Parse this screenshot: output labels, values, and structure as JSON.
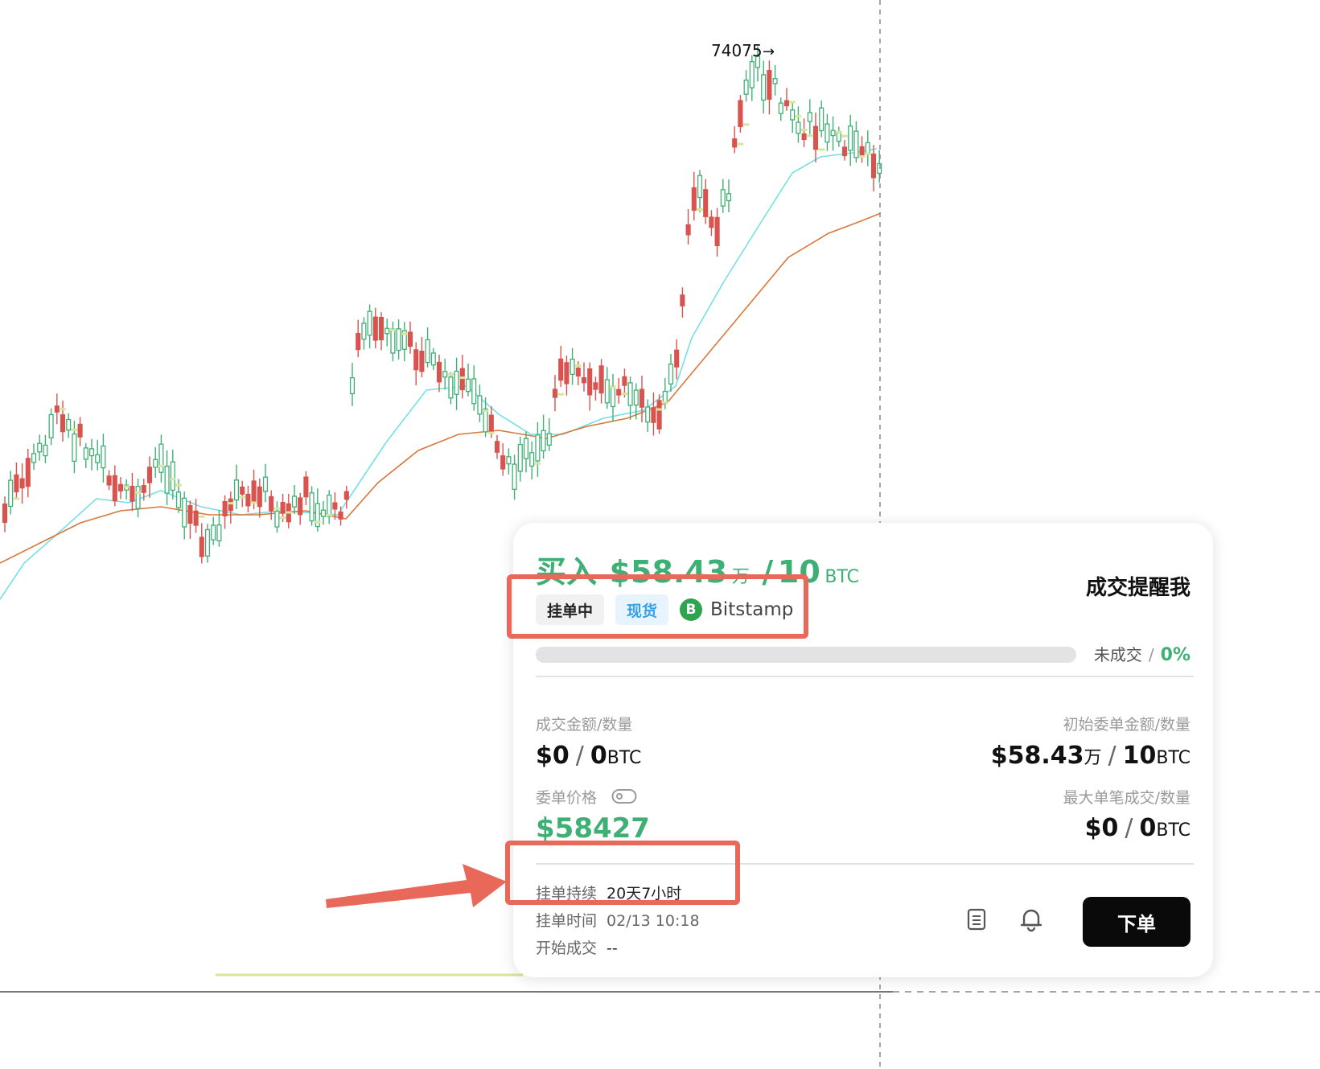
{
  "chart": {
    "peak_label": "74075",
    "colors": {
      "up": "#3fb075",
      "down": "#d9534f",
      "ma_fast": "#74e0e6",
      "ma_slow": "#d9773a",
      "volume_profile": "#d7e5a0"
    }
  },
  "order": {
    "side": "买入",
    "amount": "$58.43",
    "amount_unit": "万",
    "separator": "/",
    "quantity": "10",
    "quantity_unit": "BTC",
    "remind_label": "成交提醒我",
    "status_tag": "挂单中",
    "type_tag": "现货",
    "exchange_icon": "bitstamp-icon",
    "exchange_icon_letter": "B",
    "exchange_name": "Bitstamp",
    "progress": {
      "label": "未成交",
      "separator": "/",
      "percent": "0%",
      "fill_fraction": 0
    },
    "filled": {
      "label": "成交金额/数量",
      "amount": "$0",
      "separator": "/",
      "quantity": "0",
      "unit": "BTC"
    },
    "initial": {
      "label": "初始委单金额/数量",
      "amount": "$58.43",
      "amount_unit": "万",
      "separator": "/",
      "quantity": "10",
      "unit": "BTC"
    },
    "price": {
      "label": "委单价格",
      "icon": "tag-icon",
      "value": "$58427"
    },
    "max_fill": {
      "label": "最大单笔成交/数量",
      "amount": "$0",
      "separator": "/",
      "quantity": "0",
      "unit": "BTC"
    },
    "duration": {
      "label": "挂单持续",
      "value": "20天7小时"
    },
    "placed_time": {
      "label": "挂单时间",
      "value": "02/13 10:18"
    },
    "start_fill": {
      "label": "开始成交",
      "value": "--"
    },
    "actions": {
      "notes_icon": "document-icon",
      "alert_icon": "bell-icon",
      "order_button": "下单"
    }
  },
  "annotation": {
    "color": "#e8685a",
    "arrow_icon": "arrow-right-icon"
  }
}
